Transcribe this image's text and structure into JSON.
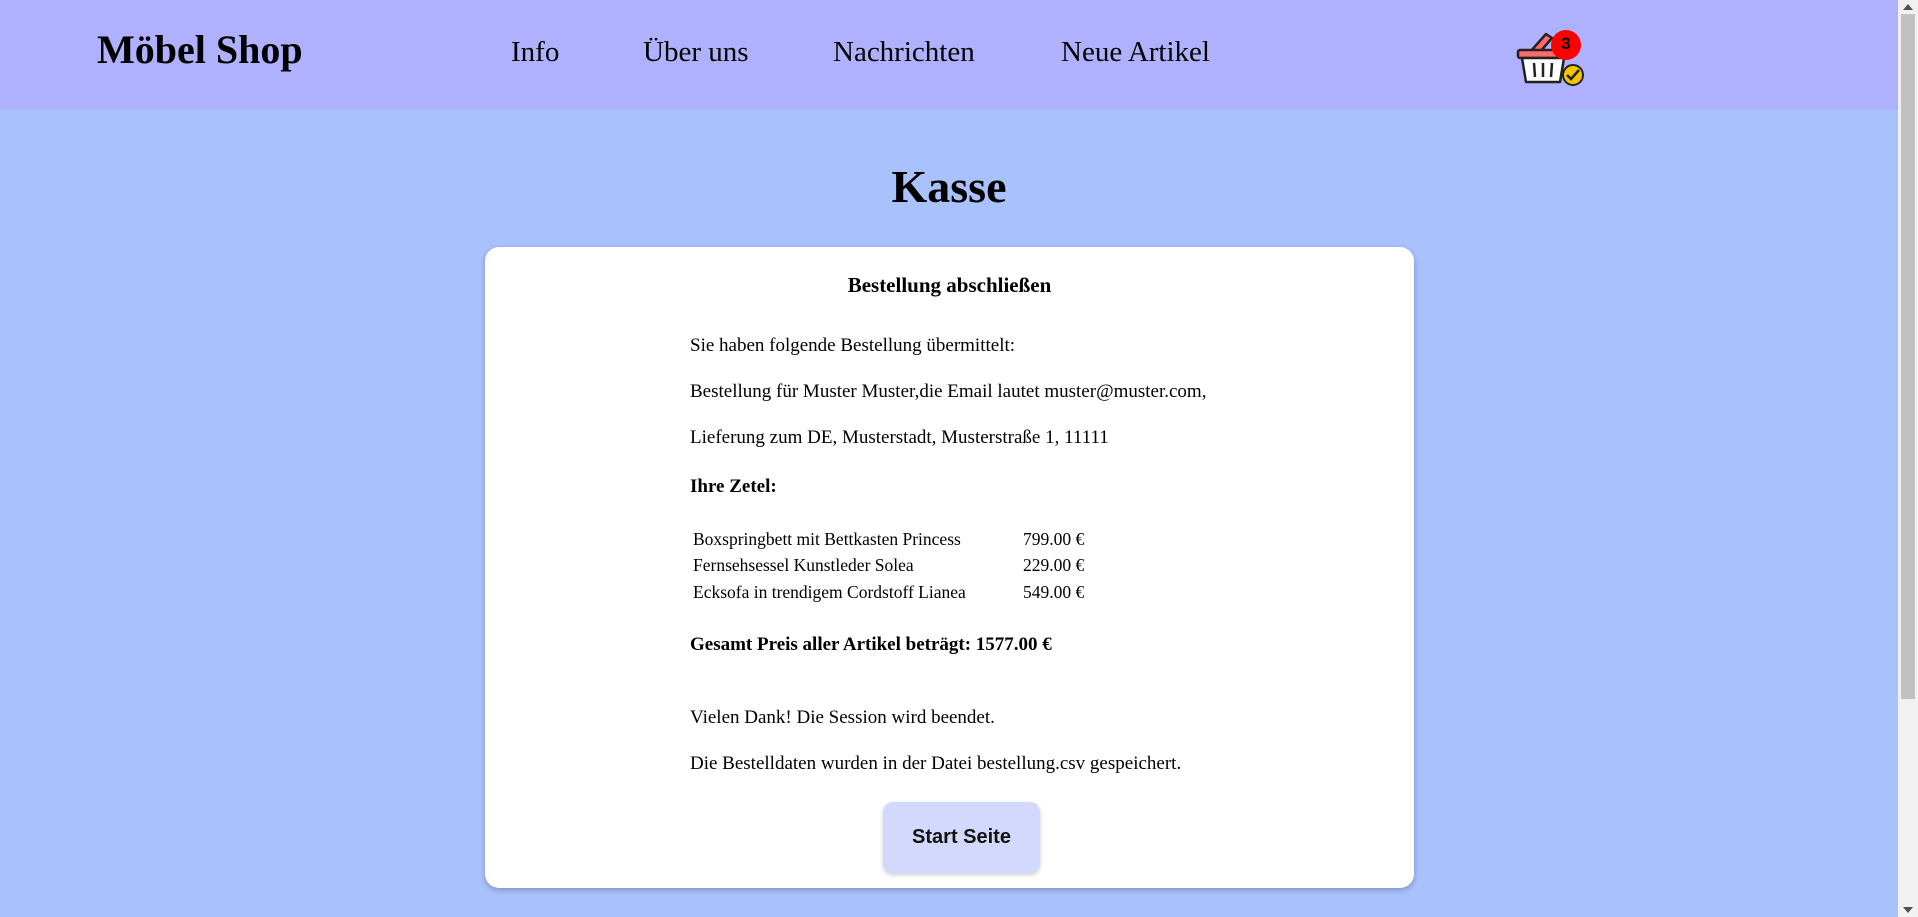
{
  "header": {
    "logo": "Möbel Shop",
    "nav": [
      "Info",
      "Über uns",
      "Nachrichten",
      "Neue Artikel"
    ],
    "cart_count": "3",
    "cart_icon": "shopping-basket-icon"
  },
  "page": {
    "title": "Kasse"
  },
  "card": {
    "title": "Bestellung abschließen",
    "intro": "Sie haben folgende Bestellung übermittelt:",
    "customer": "Bestellung für Muster Muster,die Email lautet muster@muster.com,",
    "delivery": "Lieferung zum DE, Musterstadt, Musterstraße 1, 11111",
    "items_heading": "Ihre Zetel:",
    "items": [
      {
        "name": "Boxspringbett mit Bettkasten Princess",
        "price": "799.00 €"
      },
      {
        "name": "Fernsehsessel Kunstleder Solea",
        "price": "229.00 €"
      },
      {
        "name": "Ecksofa in trendigem Cordstoff Lianea",
        "price": "549.00 €"
      }
    ],
    "total": "Gesamt Preis aller Artikel beträgt: 1577.00 €",
    "thanks": "Vielen Dank! Die Session wird beendet.",
    "saved_note": "Die Bestelldaten wurden in der Datei bestellung.csv gespeichert.",
    "start_button": "Start Seite"
  },
  "colors": {
    "header_bg": "#b0b1fe",
    "page_bg": "#a9c1fd",
    "button_bg": "#d3d9fc",
    "badge": "#ff0000"
  }
}
